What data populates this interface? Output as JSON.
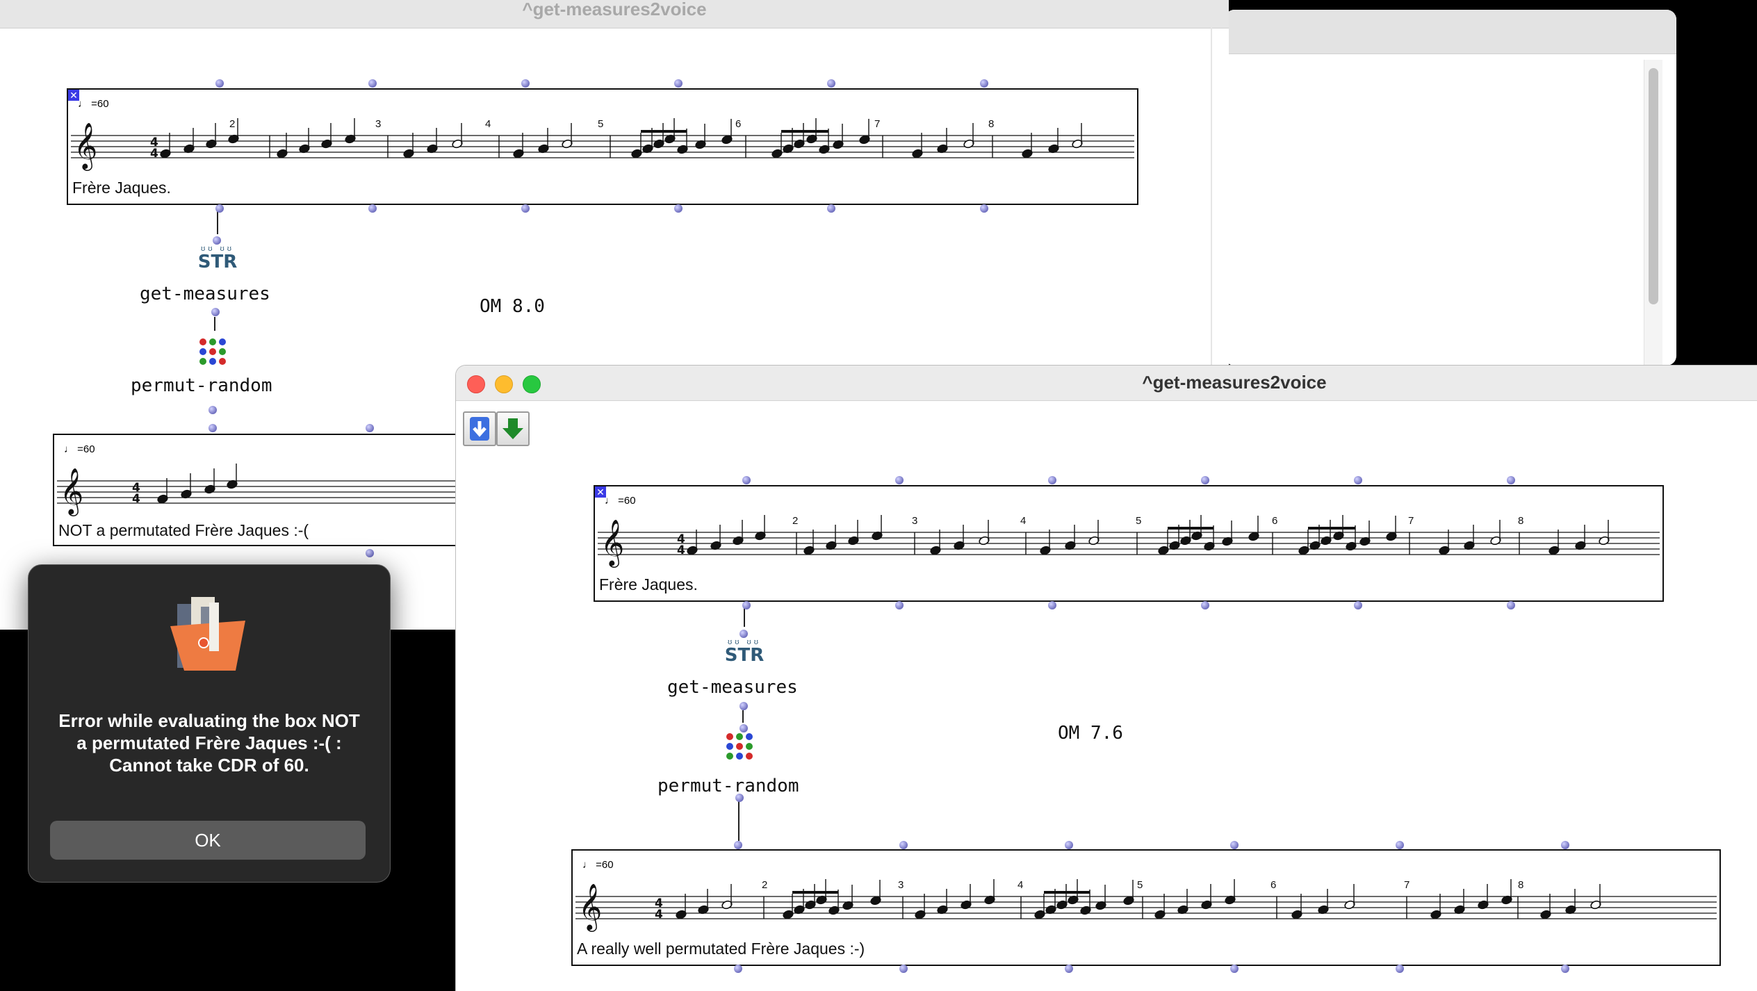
{
  "back_window": {
    "title": "^get-measures2voice",
    "version_label": "OM 8.0",
    "score_top": {
      "tempo": "=60",
      "caption": "Frère Jaques.",
      "measure_numbers": [
        "2",
        "3",
        "4",
        "5",
        "6",
        "7",
        "8"
      ]
    },
    "box1": {
      "label": "get-measures",
      "icon_text": "STR"
    },
    "box2": {
      "label": "permut-random"
    },
    "score_bottom": {
      "tempo": "=60",
      "caption": "NOT a permutated Frère Jaques :-("
    }
  },
  "front_window": {
    "title": "^get-measures2voice",
    "version_label": "OM 7.6",
    "score_top": {
      "tempo": "=60",
      "caption": "Frère Jaques.",
      "measure_numbers": [
        "2",
        "3",
        "4",
        "5",
        "6",
        "7",
        "8"
      ]
    },
    "box1": {
      "label": "get-measures",
      "icon_text": "STR"
    },
    "box2": {
      "label": "permut-random"
    },
    "score_bottom": {
      "tempo": "=60",
      "caption": "A really well permutated Frère Jaques :-)",
      "measure_numbers": [
        "2",
        "3",
        "4",
        "5",
        "6",
        "7",
        "8"
      ]
    }
  },
  "dialog": {
    "message": "Error while evaluating the box NOT a permutated Frère Jaques :-( : Cannot take CDR of 60.",
    "ok_label": "OK"
  },
  "colors": {
    "dialog_bg": "#282828",
    "inlet_dot": "#7f7fd0",
    "close_red": "#fe5f57",
    "minimize_yellow": "#febc2e",
    "zoom_green": "#28c840"
  }
}
